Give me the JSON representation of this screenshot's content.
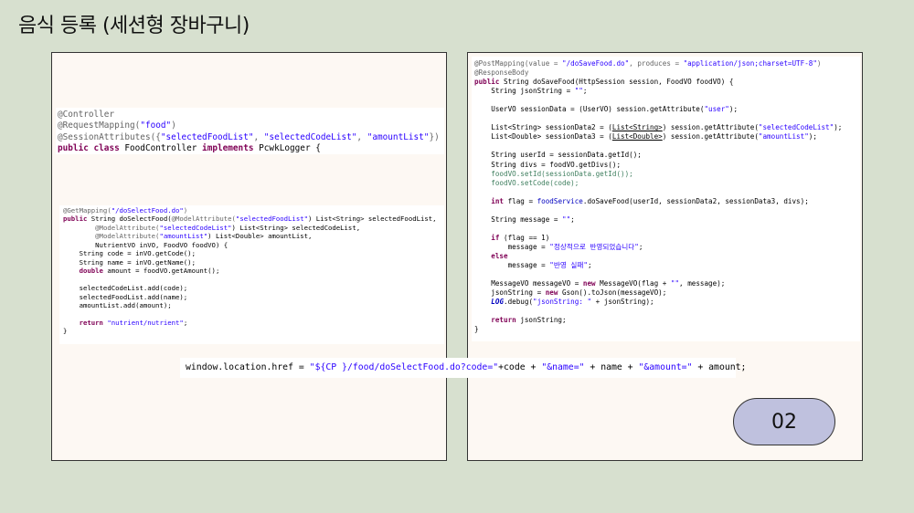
{
  "slide": {
    "title": "음식 등록 (세션형 장바구니)",
    "page_number": "02"
  },
  "code_controller": {
    "l1": "@Controller",
    "l2a": "@RequestMapping(",
    "l2b": "\"food\"",
    "l2c": ")",
    "l3a": "@SessionAttributes({",
    "l3b": "\"selectedFoodList\"",
    "l3c": ", ",
    "l3d": "\"selectedCodeList\"",
    "l3e": ", ",
    "l3f": "\"amountList\"",
    "l3g": "})",
    "l4a": "public class",
    "l4b": " FoodController ",
    "l4c": "implements",
    "l4d": " PcwkLogger {"
  },
  "code_select": {
    "l1a": "@GetMapping(",
    "l1b": "\"/doSelectFood.do\"",
    "l1c": ")",
    "l2a": "public",
    "l2b": " String doSelectFood(",
    "l2c": "@ModelAttribute(",
    "l2d": "\"selectedFoodList\"",
    "l2e": ") List<String> selectedFoodList,",
    "l3a": "        ",
    "l3b": "@ModelAttribute(",
    "l3c": "\"selectedCodeList\"",
    "l3d": ") List<String> selectedCodeList,",
    "l4a": "        ",
    "l4b": "@ModelAttribute(",
    "l4c": "\"amountList\"",
    "l4d": ") List<Double> amountList,",
    "l5": "        NutrientVO inVO, FoodVO foodVO) {",
    "l6": "    String code = inVO.getCode();",
    "l7": "    String name = inVO.getName();",
    "l8a": "    double",
    "l8b": " amount = foodVO.getAmount();",
    "l9": "    selectedCodeList.add(code);",
    "l10": "    selectedFoodList.add(name);",
    "l11": "    amountList.add(amount);",
    "l12a": "    return",
    "l12b": " \"nutrient/nutrient\"",
    "l12c": ";",
    "l13": "}"
  },
  "code_save": {
    "l1a": "@PostMapping(value = ",
    "l1b": "\"/doSaveFood.do\"",
    "l1c": ", produces = ",
    "l1d": "\"application/json;charset=UTF-8\"",
    "l1e": ")",
    "l2": "@ResponseBody",
    "l3a": "public",
    "l3b": " String doSaveFood(HttpSession session, FoodVO foodVO) {",
    "l4a": "    String jsonString = ",
    "l4b": "\"\"",
    "l4c": ";",
    "l5": "    UserVO sessionData = (UserVO) session.getAttribute(",
    "l5b": "\"user\"",
    "l5c": ");",
    "l6a": "    List<String> sessionData2 = (",
    "l6b": "List<String>",
    "l6c": ") session.getAttribute(",
    "l6d": "\"selectedCodeList\"",
    "l6e": ");",
    "l7a": "    List<Double> sessionData3 = (",
    "l7b": "List<Double>",
    "l7c": ") session.getAttribute(",
    "l7d": "\"amountList\"",
    "l7e": ");",
    "l8": "    String userId = sessionData.getId();",
    "l9": "    String divs = foodVO.getDivs();",
    "l10": "    foodVO.setId(sessionData.getId());",
    "l11": "    foodVO.setCode(code);",
    "l12a": "    int",
    "l12b": " flag = ",
    "l12c": "foodService",
    "l12d": ".doSaveFood(userId, sessionData2, sessionData3, divs);",
    "l13a": "    String message = ",
    "l13b": "\"\"",
    "l13c": ";",
    "l14a": "    if",
    "l14b": " (flag == 1)",
    "l15a": "        message = ",
    "l15b": "\"정상적으로 반영되었습니다\"",
    "l15c": ";",
    "l16": "    else",
    "l17a": "        message = ",
    "l17b": "\"반영 실패\"",
    "l17c": ";",
    "l18a": "    MessageVO messageVO = ",
    "l18b": "new",
    "l18c": " MessageVO(flag + ",
    "l18d": "\"\"",
    "l18e": ", message);",
    "l19a": "    jsonString = ",
    "l19b": "new",
    "l19c": " Gson().toJson(messageVO);",
    "l20a": "    ",
    "l20b": "LOG",
    "l20c": ".debug(",
    "l20d": "\"jsonString: \"",
    "l20e": " + jsonString);",
    "l21a": "    return",
    "l21b": " jsonString;",
    "l22": "}"
  },
  "redirect": {
    "a": "window.location.href = ",
    "b": "\"${CP }/food/doSelectFood.do?code=\"",
    "c": "+code + ",
    "d": "\"&name=\"",
    "e": " + name + ",
    "f": "\"&amount=\"",
    "g": " + amount;"
  }
}
